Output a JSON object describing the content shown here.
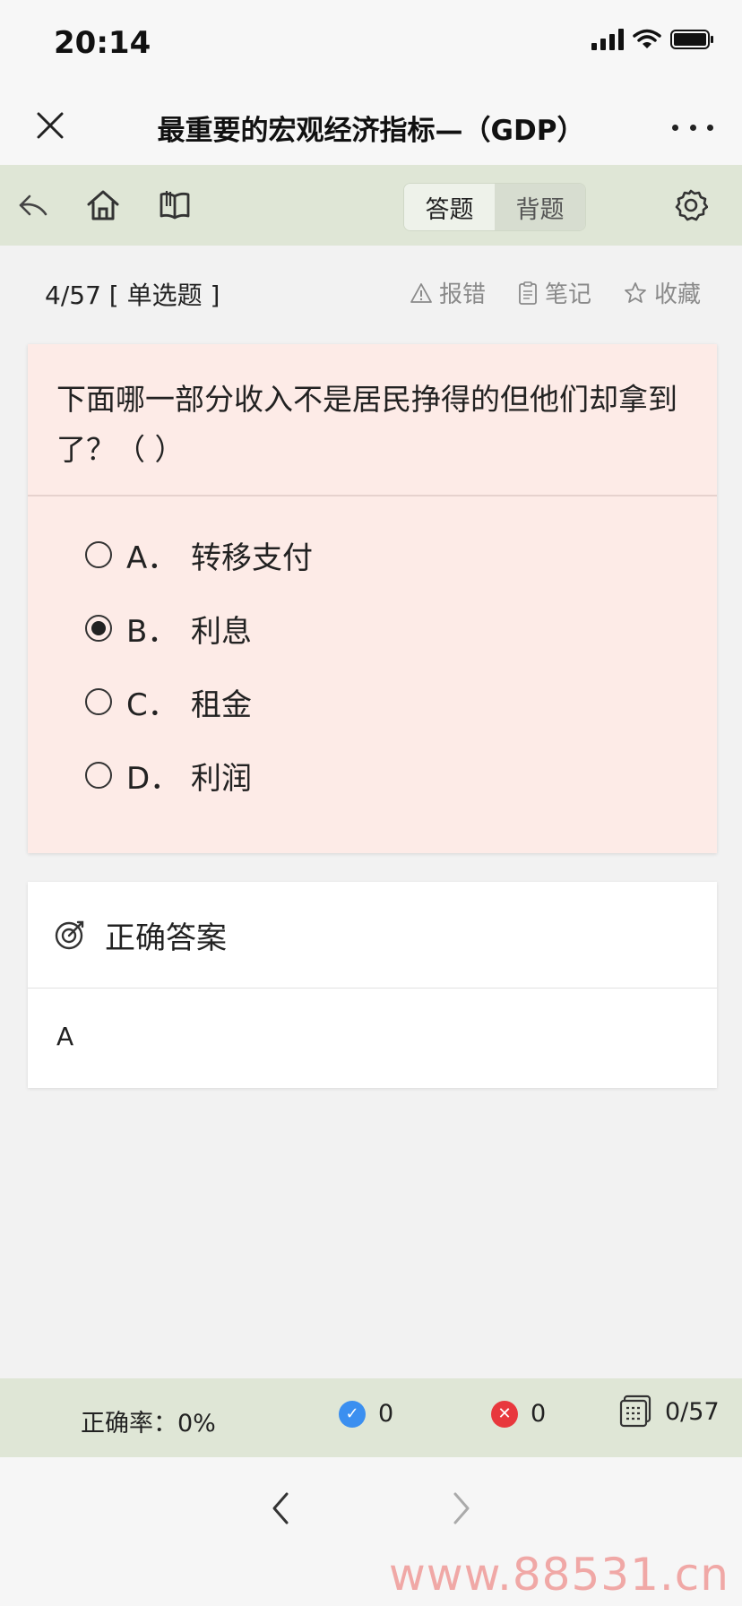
{
  "status_bar": {
    "time": "20:14"
  },
  "header": {
    "title": "最重要的宏观经济指标—（GDP）"
  },
  "toolbar": {
    "icons": [
      "back-arrow-icon",
      "home-icon",
      "book-icon",
      "gear-icon"
    ],
    "modes": [
      {
        "label": "答题",
        "active": true
      },
      {
        "label": "背题",
        "active": false
      }
    ]
  },
  "meta": {
    "index": "4/57",
    "type": "[ 单选题 ]",
    "actions": [
      {
        "icon": "warning-icon",
        "label": "报错"
      },
      {
        "icon": "notes-icon",
        "label": "笔记"
      },
      {
        "icon": "star-icon",
        "label": "收藏"
      }
    ]
  },
  "question": {
    "text": "下面哪一部分收入不是居民挣得的但他们却拿到了？（ ）",
    "options": [
      {
        "letter": "A．",
        "text": "转移支付",
        "selected": false
      },
      {
        "letter": "B．",
        "text": "利息",
        "selected": true
      },
      {
        "letter": "C．",
        "text": "租金",
        "selected": false
      },
      {
        "letter": "D．",
        "text": "利润",
        "selected": false
      }
    ]
  },
  "answer": {
    "title": "正确答案",
    "value": "A"
  },
  "stats": {
    "accuracy": "正确率：0%",
    "correct_count": "0",
    "wrong_count": "0",
    "progress": "0/57",
    "colors": {
      "correct": "#3b8ff0",
      "wrong": "#e8383d"
    }
  },
  "watermark": "www.88531.cn"
}
